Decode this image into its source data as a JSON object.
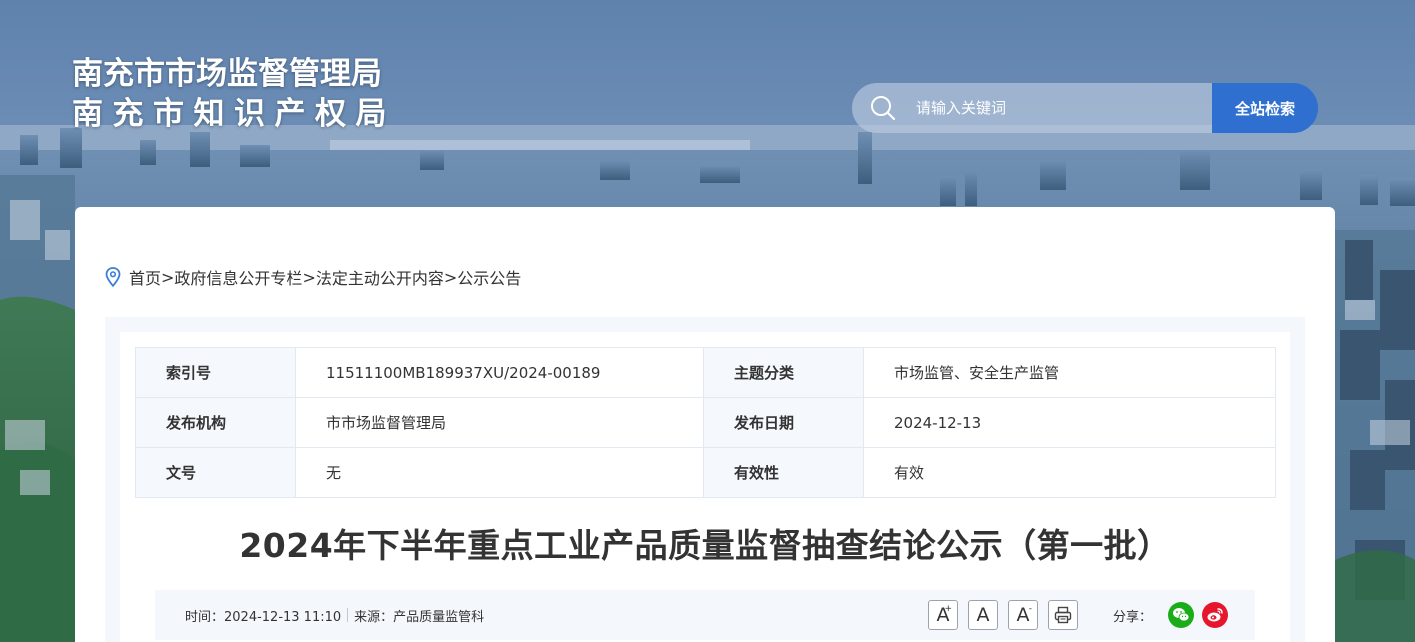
{
  "site": {
    "title_line1": "南充市市场监督管理局",
    "title_line2": "南充市知识产权局"
  },
  "search": {
    "placeholder": "请输入关键词",
    "button_label": "全站检索"
  },
  "breadcrumb": {
    "items": [
      "首页",
      "政府信息公开专栏",
      "法定主动公开内容",
      "公示公告"
    ],
    "separator": ">"
  },
  "meta": {
    "rows": [
      {
        "k1": "索引号",
        "v1": "11511100MB189937XU/2024-00189",
        "k2": "主题分类",
        "v2": "市场监管、安全生产监管"
      },
      {
        "k1": "发布机构",
        "v1": "市市场监督管理局",
        "k2": "发布日期",
        "v2": "2024-12-13"
      },
      {
        "k1": "文号",
        "v1": "无",
        "k2": "有效性",
        "v2": "有效"
      }
    ]
  },
  "article": {
    "title": "2024年下半年重点工业产品质量监督抽查结论公示（第一批）",
    "time": "时间：2024-12-13 11:10",
    "source": "来源：产品质量监管科"
  },
  "tools": {
    "font_increase": "A",
    "font_increase_sup": "+",
    "font_reset": "A",
    "font_decrease": "A",
    "font_decrease_sup": "-"
  },
  "share": {
    "label": "分享："
  },
  "colors": {
    "accent": "#2f6fd0",
    "wechat": "#1aad19",
    "weibo": "#e6162d"
  }
}
